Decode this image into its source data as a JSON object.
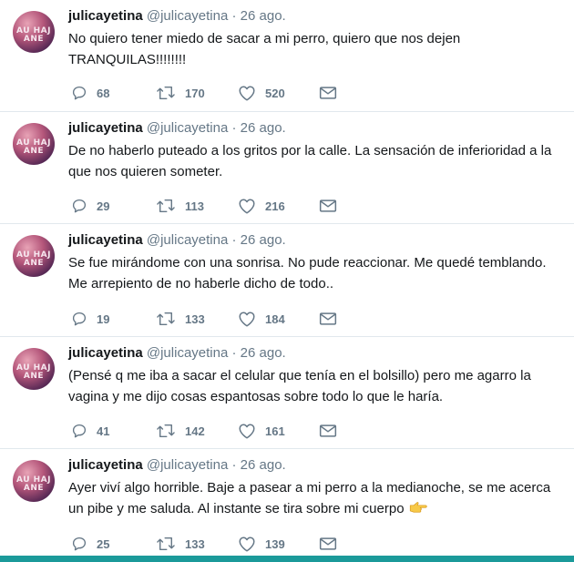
{
  "account": {
    "display_name": "julicayetina",
    "handle": "@julicayetina",
    "avatar_text": "AU HAJ\nANE"
  },
  "tweets": [
    {
      "date": "26 ago.",
      "text": "No quiero tener miedo de sacar a mi perro, quiero que nos dejen TRANQUILAS!!!!!!!!",
      "replies": "68",
      "retweets": "170",
      "likes": "520"
    },
    {
      "date": "26 ago.",
      "text": "De no haberlo puteado a los gritos por la calle. La sensación de inferioridad a la que nos quieren someter.",
      "replies": "29",
      "retweets": "113",
      "likes": "216"
    },
    {
      "date": "26 ago.",
      "text": "Se fue mirándome con una sonrisa. No pude reaccionar. Me quedé temblando. Me arrepiento de no haberle dicho de todo..",
      "replies": "19",
      "retweets": "133",
      "likes": "184"
    },
    {
      "date": "26 ago.",
      "text": "(Pensé q me iba a sacar el celular que tenía en el bolsillo) pero me agarro la vagina y me dijo cosas espantosas sobre todo lo que le haría.",
      "replies": "41",
      "retweets": "142",
      "likes": "161"
    },
    {
      "date": "26 ago.",
      "text": "Ayer viví algo horrible. Baje a pasear a mi perro a la medianoche, se me acerca un pibe y me saluda. Al instante se tira sobre mi cuerpo",
      "emoji": "pointing-right-hand-emoji",
      "replies": "25",
      "retweets": "133",
      "likes": "139"
    }
  ],
  "separator": "·",
  "colors": {
    "text": "#14171a",
    "secondary": "#657786",
    "divider": "#e1e8ed",
    "bottom_bar": "#1b9a9a"
  },
  "icons": {
    "reply": "reply-icon",
    "retweet": "retweet-icon",
    "like": "heart-icon",
    "message": "envelope-icon"
  }
}
